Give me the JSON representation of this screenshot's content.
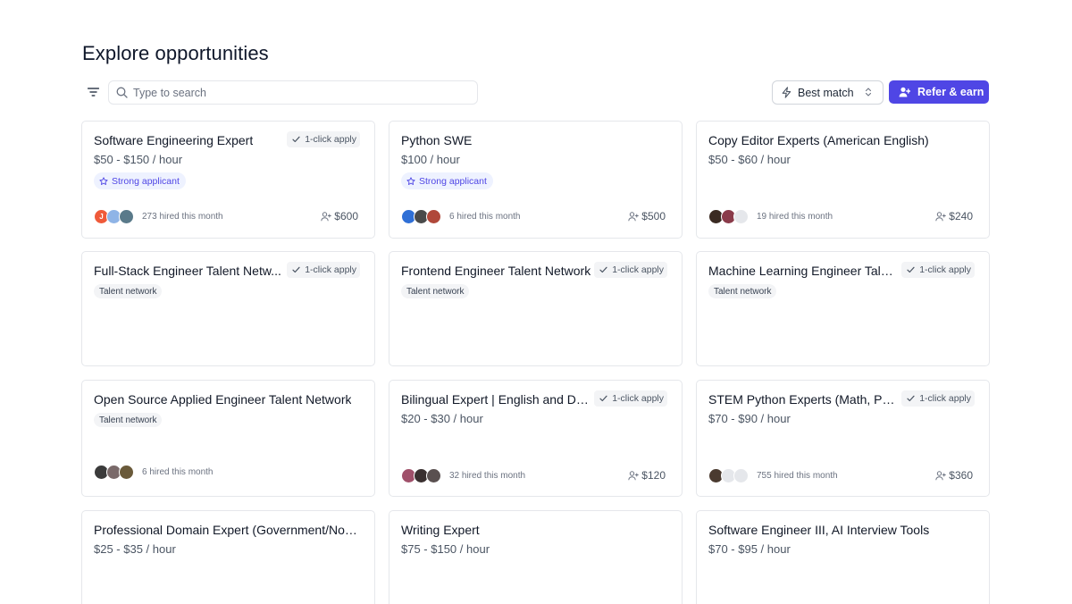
{
  "page": {
    "title": "Explore opportunities"
  },
  "toolbar": {
    "search_placeholder": "Type to search",
    "sort_label": "Best match",
    "refer_label": "Refer & earn"
  },
  "colors": {
    "accent": "#4f46e5",
    "badge_bg": "#eef2ff"
  },
  "cards": [
    {
      "title": "Software Engineering Expert",
      "apply": "1-click apply",
      "rate": "$50 - $150 / hour",
      "badge": "Strong applicant",
      "hired": "273 hired this month",
      "reward": "$600"
    },
    {
      "title": "Python SWE",
      "rate": "$100 / hour",
      "badge": "Strong applicant",
      "hired": "6 hired this month",
      "reward": "$500"
    },
    {
      "title": "Copy Editor Experts (American English)",
      "rate": "$50 - $60 / hour",
      "hired": "19 hired this month",
      "reward": "$240"
    },
    {
      "title": "Full-Stack Engineer Talent Netw...",
      "apply": "1-click apply",
      "tag": "Talent network"
    },
    {
      "title": "Frontend Engineer Talent Network",
      "apply": "1-click apply",
      "tag": "Talent network"
    },
    {
      "title": "Machine Learning Engineer Tale...",
      "apply": "1-click apply",
      "tag": "Talent network"
    },
    {
      "title": "Open Source Applied Engineer Talent Network",
      "tag": "Talent network",
      "hired": "6 hired this month"
    },
    {
      "title": "Bilingual Expert | English and Du...",
      "apply": "1-click apply",
      "rate": "$20 - $30 / hour",
      "hired": "32 hired this month",
      "reward": "$120"
    },
    {
      "title": "STEM Python Experts (Math, Ph...",
      "apply": "1-click apply",
      "rate": "$70 - $90 / hour",
      "hired": "755 hired this month",
      "reward": "$360"
    },
    {
      "title": "Professional Domain Expert (Government/Non...",
      "rate": "$25 - $35 / hour"
    },
    {
      "title": "Writing Expert",
      "rate": "$75 - $150 / hour"
    },
    {
      "title": "Software Engineer III, AI Interview Tools",
      "rate": "$70 - $95 / hour"
    }
  ]
}
